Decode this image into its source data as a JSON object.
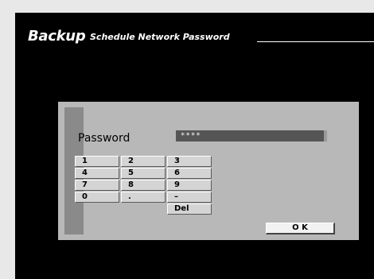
{
  "header": {
    "title": "Backup",
    "subtitle": "Schedule Network Password"
  },
  "dialog": {
    "password_label": "Password",
    "password_value": "****",
    "keypad": {
      "k1": "1",
      "k2": "2",
      "k3": "3",
      "k4": "4",
      "k5": "5",
      "k6": "6",
      "k7": "7",
      "k8": "8",
      "k9": "9",
      "k0": "0",
      "kdot": ".",
      "kdash": "–",
      "kdel": "Del"
    },
    "ok_label": "O K"
  }
}
